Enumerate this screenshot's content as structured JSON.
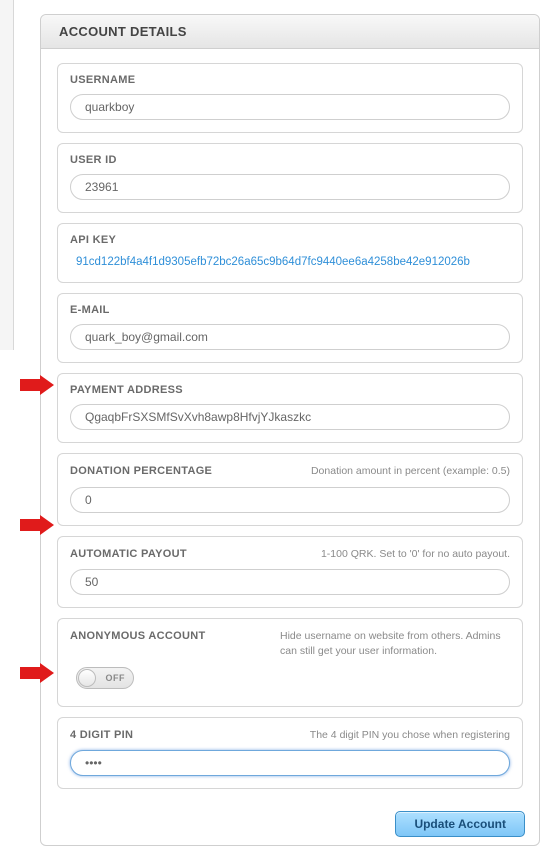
{
  "panel_title": "ACCOUNT DETAILS",
  "fields": {
    "username": {
      "label": "USERNAME",
      "value": "quarkboy"
    },
    "userid": {
      "label": "USER ID",
      "value": "23961"
    },
    "apikey": {
      "label": "API KEY",
      "value": "91cd122bf4a4f1d9305efb72bc26a65c9b64d7fc9440ee6a4258be42e912026b"
    },
    "email": {
      "label": "E-MAIL",
      "value": "quark_boy@gmail.com"
    },
    "payaddr": {
      "label": "PAYMENT ADDRESS",
      "value": "QgaqbFrSXSMfSvXvh8awp8HfvjYJkaszkc"
    },
    "donation": {
      "label": "DONATION PERCENTAGE",
      "hint": "Donation amount in percent (example: 0.5)",
      "value": "0"
    },
    "autopayout": {
      "label": "AUTOMATIC PAYOUT",
      "hint": "1-100 QRK. Set to '0' for no auto payout.",
      "value": "50"
    },
    "anon": {
      "label": "ANONYMOUS ACCOUNT",
      "hint": "Hide username on website from others. Admins can still get your user information.",
      "toggle": "OFF"
    },
    "pin": {
      "label": "4 DIGIT PIN",
      "hint": "The 4 digit PIN you chose when registering",
      "value": "••••"
    }
  },
  "buttons": {
    "update": "Update Account"
  }
}
